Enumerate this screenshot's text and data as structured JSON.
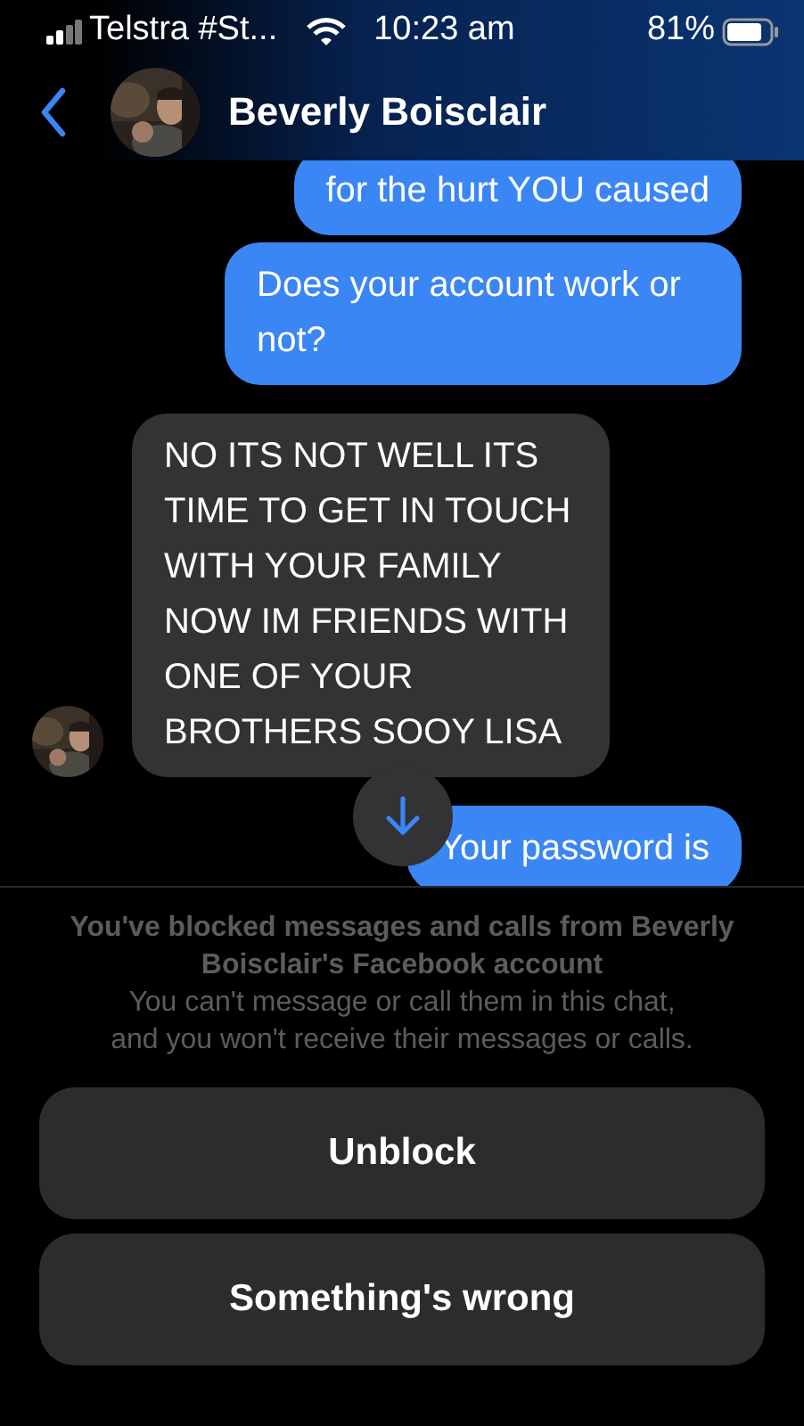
{
  "status_bar": {
    "carrier": "Telstra #St...",
    "time": "10:23 am",
    "battery": "81%"
  },
  "header": {
    "contact_name": "Beverly Boisclair"
  },
  "messages": [
    {
      "kind": "outgoing",
      "text": "for the hurt YOU caused"
    },
    {
      "kind": "outgoing",
      "text": "Does your account work or not?"
    },
    {
      "kind": "incoming",
      "text": "NO ITS NOT WELL ITS TIME TO GET IN TOUCH WITH YOUR FAMILY NOW IM FRIENDS WITH ONE OF YOUR BROTHERS SOOY LISA"
    },
    {
      "kind": "outgoing",
      "text": "Your password is"
    }
  ],
  "block_notice": {
    "title": "You've blocked messages and calls from Beverly Boisclair's Facebook account",
    "body": "You can't message or call them in this chat, and you won't receive their messages or calls."
  },
  "buttons": [
    "Unblock",
    "Something's wrong"
  ]
}
